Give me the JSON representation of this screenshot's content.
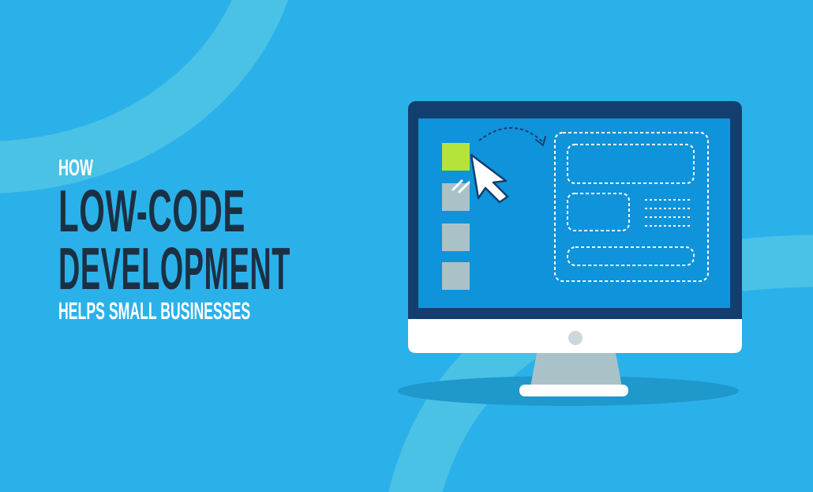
{
  "headline": {
    "line1": "HOW",
    "line2": "LOW-CODE",
    "line3": "DEVELOPMENT",
    "line4": "HELPS SMALL BUSINESSES"
  },
  "colors": {
    "background": "#2bb1ea",
    "background_arc": "#4ac2e6",
    "headline_dark": "#1b3043",
    "headline_light": "#ffffff",
    "monitor_bezel": "#123f6e",
    "monitor_screen": "#0f93db",
    "monitor_chin": "#ffffff",
    "monitor_stand": "#a9c2c8",
    "accent_green": "#b4e43a",
    "placeholder_gray": "#a9c2c8",
    "floor_shadow": "#1f98cc"
  },
  "icons": {
    "cursor": "mouse-pointer-icon",
    "power": "power-button-icon"
  }
}
